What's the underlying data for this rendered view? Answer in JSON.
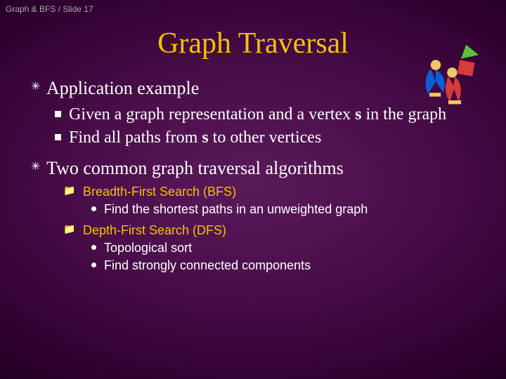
{
  "header": "Graph & BFS / Slide 17",
  "title": "Graph Traversal",
  "b1": {
    "head": "Application example",
    "sub1a": "Given a graph representation and a vertex ",
    "sub1b": " in the graph",
    "sub1_s": "s",
    "sub2a": "Find all paths from ",
    "sub2b": " to other vertices",
    "sub2_s": "s"
  },
  "b2": {
    "head": "Two common graph traversal algorithms",
    "alg1": {
      "name": "Breadth-First Search (BFS)",
      "p1": "Find the shortest paths in an unweighted graph"
    },
    "alg2": {
      "name": "Depth-First Search (DFS)",
      "p1": "Topological sort",
      "p2": "Find strongly connected components"
    }
  }
}
